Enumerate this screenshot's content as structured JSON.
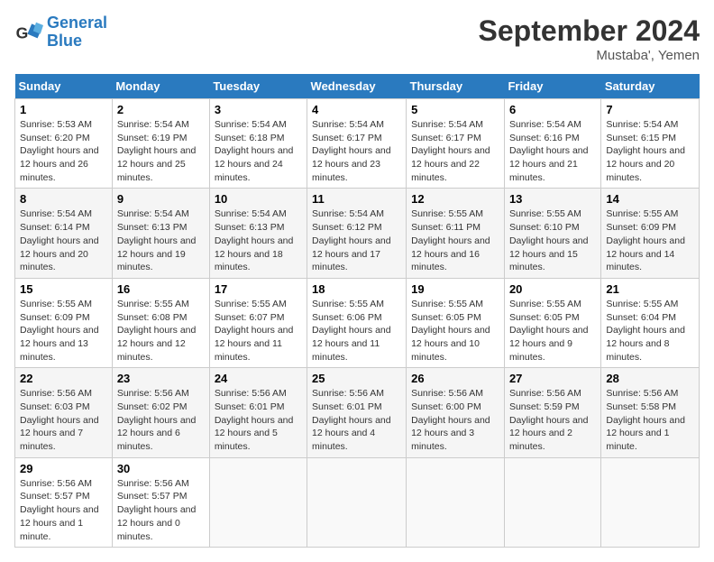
{
  "header": {
    "logo_line1": "General",
    "logo_line2": "Blue",
    "month_title": "September 2024",
    "location": "Mustaba', Yemen"
  },
  "days_of_week": [
    "Sunday",
    "Monday",
    "Tuesday",
    "Wednesday",
    "Thursday",
    "Friday",
    "Saturday"
  ],
  "weeks": [
    [
      {
        "num": "1",
        "sunrise": "5:53 AM",
        "sunset": "6:20 PM",
        "daylight": "12 hours and 26 minutes."
      },
      {
        "num": "2",
        "sunrise": "5:54 AM",
        "sunset": "6:19 PM",
        "daylight": "12 hours and 25 minutes."
      },
      {
        "num": "3",
        "sunrise": "5:54 AM",
        "sunset": "6:18 PM",
        "daylight": "12 hours and 24 minutes."
      },
      {
        "num": "4",
        "sunrise": "5:54 AM",
        "sunset": "6:17 PM",
        "daylight": "12 hours and 23 minutes."
      },
      {
        "num": "5",
        "sunrise": "5:54 AM",
        "sunset": "6:17 PM",
        "daylight": "12 hours and 22 minutes."
      },
      {
        "num": "6",
        "sunrise": "5:54 AM",
        "sunset": "6:16 PM",
        "daylight": "12 hours and 21 minutes."
      },
      {
        "num": "7",
        "sunrise": "5:54 AM",
        "sunset": "6:15 PM",
        "daylight": "12 hours and 20 minutes."
      }
    ],
    [
      {
        "num": "8",
        "sunrise": "5:54 AM",
        "sunset": "6:14 PM",
        "daylight": "12 hours and 20 minutes."
      },
      {
        "num": "9",
        "sunrise": "5:54 AM",
        "sunset": "6:13 PM",
        "daylight": "12 hours and 19 minutes."
      },
      {
        "num": "10",
        "sunrise": "5:54 AM",
        "sunset": "6:13 PM",
        "daylight": "12 hours and 18 minutes."
      },
      {
        "num": "11",
        "sunrise": "5:54 AM",
        "sunset": "6:12 PM",
        "daylight": "12 hours and 17 minutes."
      },
      {
        "num": "12",
        "sunrise": "5:55 AM",
        "sunset": "6:11 PM",
        "daylight": "12 hours and 16 minutes."
      },
      {
        "num": "13",
        "sunrise": "5:55 AM",
        "sunset": "6:10 PM",
        "daylight": "12 hours and 15 minutes."
      },
      {
        "num": "14",
        "sunrise": "5:55 AM",
        "sunset": "6:09 PM",
        "daylight": "12 hours and 14 minutes."
      }
    ],
    [
      {
        "num": "15",
        "sunrise": "5:55 AM",
        "sunset": "6:09 PM",
        "daylight": "12 hours and 13 minutes."
      },
      {
        "num": "16",
        "sunrise": "5:55 AM",
        "sunset": "6:08 PM",
        "daylight": "12 hours and 12 minutes."
      },
      {
        "num": "17",
        "sunrise": "5:55 AM",
        "sunset": "6:07 PM",
        "daylight": "12 hours and 11 minutes."
      },
      {
        "num": "18",
        "sunrise": "5:55 AM",
        "sunset": "6:06 PM",
        "daylight": "12 hours and 11 minutes."
      },
      {
        "num": "19",
        "sunrise": "5:55 AM",
        "sunset": "6:05 PM",
        "daylight": "12 hours and 10 minutes."
      },
      {
        "num": "20",
        "sunrise": "5:55 AM",
        "sunset": "6:05 PM",
        "daylight": "12 hours and 9 minutes."
      },
      {
        "num": "21",
        "sunrise": "5:55 AM",
        "sunset": "6:04 PM",
        "daylight": "12 hours and 8 minutes."
      }
    ],
    [
      {
        "num": "22",
        "sunrise": "5:56 AM",
        "sunset": "6:03 PM",
        "daylight": "12 hours and 7 minutes."
      },
      {
        "num": "23",
        "sunrise": "5:56 AM",
        "sunset": "6:02 PM",
        "daylight": "12 hours and 6 minutes."
      },
      {
        "num": "24",
        "sunrise": "5:56 AM",
        "sunset": "6:01 PM",
        "daylight": "12 hours and 5 minutes."
      },
      {
        "num": "25",
        "sunrise": "5:56 AM",
        "sunset": "6:01 PM",
        "daylight": "12 hours and 4 minutes."
      },
      {
        "num": "26",
        "sunrise": "5:56 AM",
        "sunset": "6:00 PM",
        "daylight": "12 hours and 3 minutes."
      },
      {
        "num": "27",
        "sunrise": "5:56 AM",
        "sunset": "5:59 PM",
        "daylight": "12 hours and 2 minutes."
      },
      {
        "num": "28",
        "sunrise": "5:56 AM",
        "sunset": "5:58 PM",
        "daylight": "12 hours and 1 minute."
      }
    ],
    [
      {
        "num": "29",
        "sunrise": "5:56 AM",
        "sunset": "5:57 PM",
        "daylight": "12 hours and 1 minute."
      },
      {
        "num": "30",
        "sunrise": "5:56 AM",
        "sunset": "5:57 PM",
        "daylight": "12 hours and 0 minutes."
      },
      null,
      null,
      null,
      null,
      null
    ]
  ]
}
